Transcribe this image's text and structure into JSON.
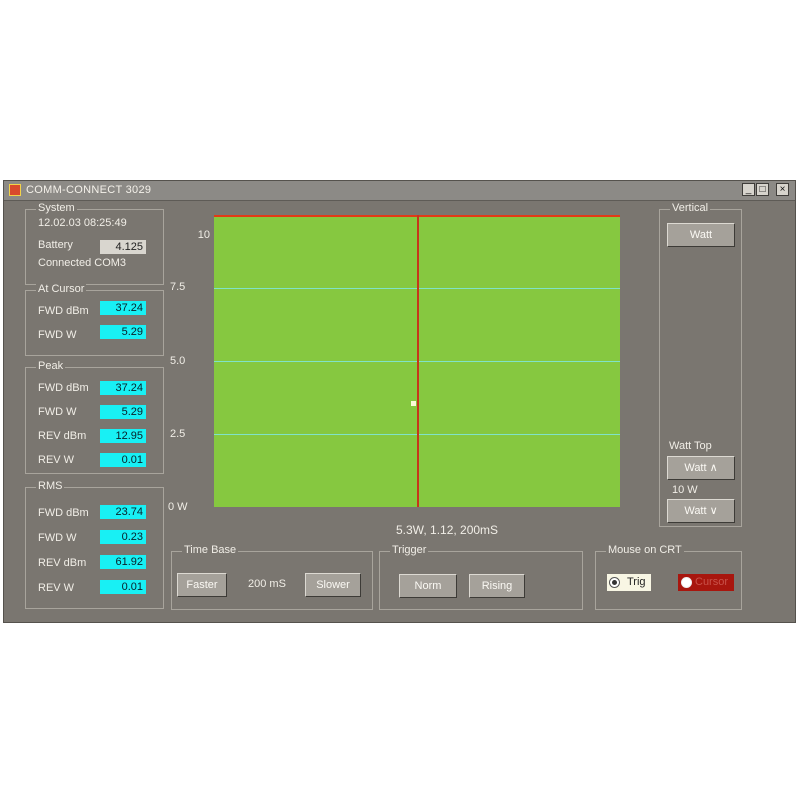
{
  "window": {
    "title": "COMM-CONNECT 3029",
    "min_glyph": "_",
    "max_glyph": "□",
    "close_glyph": "×"
  },
  "system": {
    "title": "System",
    "datetime": "12.02.03 08:25:49",
    "battery_label": "Battery",
    "battery_value": "4.125",
    "connection": "Connected COM3"
  },
  "at_cursor": {
    "title": "At Cursor",
    "rows": [
      {
        "label": "FWD dBm",
        "value": "37.24"
      },
      {
        "label": "FWD W",
        "value": "5.29"
      }
    ]
  },
  "peak": {
    "title": "Peak",
    "rows": [
      {
        "label": "FWD dBm",
        "value": "37.24"
      },
      {
        "label": "FWD W",
        "value": "5.29"
      },
      {
        "label": "REV dBm",
        "value": "12.95"
      },
      {
        "label": "REV W",
        "value": "0.01"
      }
    ]
  },
  "rms": {
    "title": "RMS",
    "rows": [
      {
        "label": "FWD dBm",
        "value": "23.74"
      },
      {
        "label": "FWD W",
        "value": "0.23"
      },
      {
        "label": "REV dBm",
        "value": "61.92"
      },
      {
        "label": "REV W",
        "value": "0.01"
      }
    ]
  },
  "plot": {
    "y_ticks": [
      "10",
      "7.5",
      "5.0",
      "2.5",
      "0 W"
    ],
    "readout": "5.3W, 1.12, 200mS",
    "cursor_fraction": 0.5,
    "background_color": "#86c840",
    "grid_color": "#7fe3c8",
    "trace_color": "#e23a16"
  },
  "vertical": {
    "title": "Vertical",
    "unit_button": "Watt",
    "top_label": "Watt Top",
    "up_button": "Watt ∧",
    "value": "10 W",
    "down_button": "Watt ∨"
  },
  "time_base": {
    "title": "Time Base",
    "faster": "Faster",
    "value": "200 mS",
    "slower": "Slower"
  },
  "trigger": {
    "title": "Trigger",
    "norm": "Norm",
    "rising": "Rising"
  },
  "mouse": {
    "title": "Mouse on CRT",
    "trig_label": "Trig",
    "cursor_label": "Cursor"
  }
}
